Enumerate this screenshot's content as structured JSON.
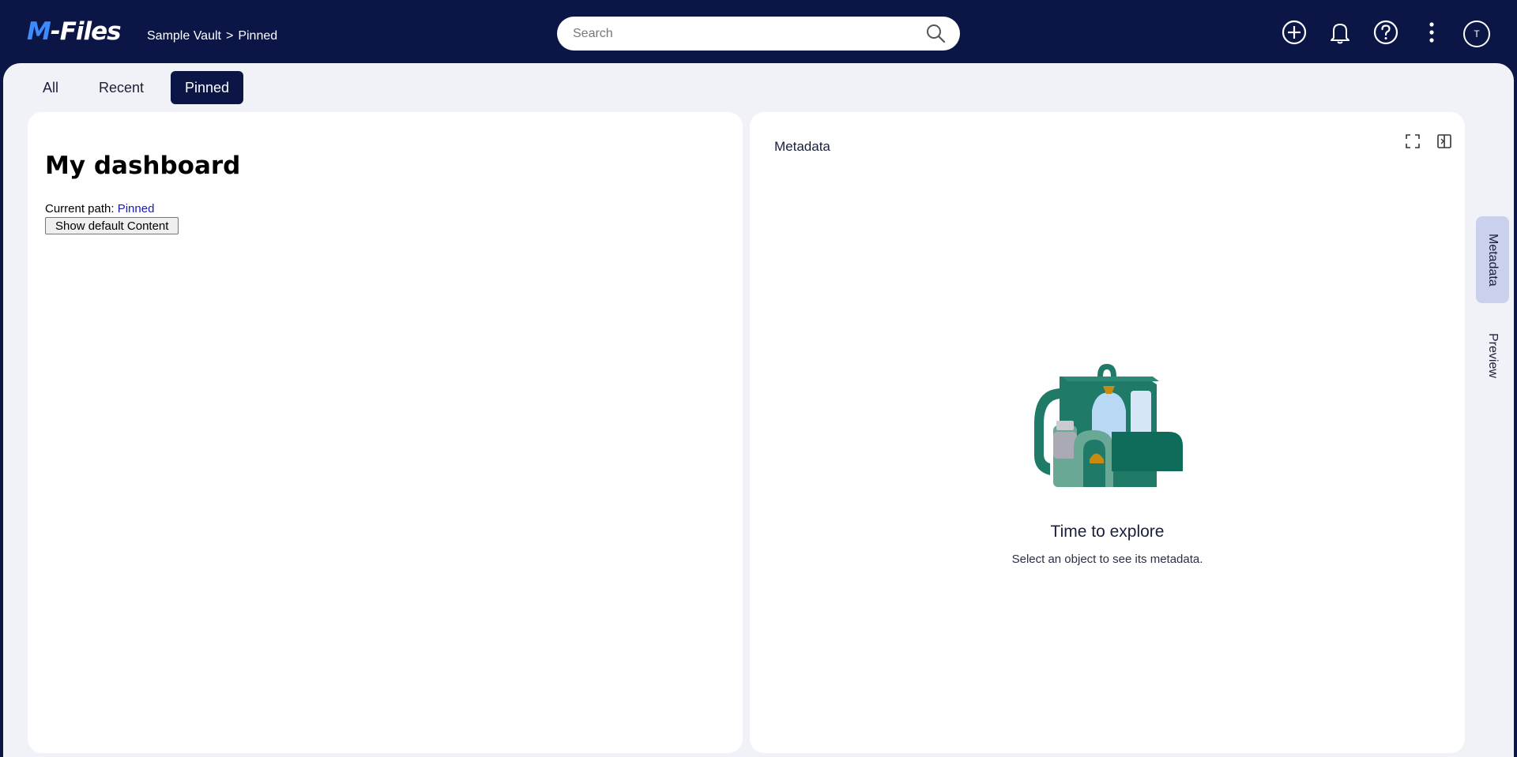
{
  "app": {
    "logo_prefix": "M",
    "logo_rest": "-Files"
  },
  "breadcrumb": {
    "vault": "Sample Vault",
    "separator": ">",
    "current": "Pinned"
  },
  "search": {
    "placeholder": "Search"
  },
  "toolbar": {
    "icons": [
      "add-icon",
      "bell-icon",
      "help-icon",
      "more-vertical-icon"
    ],
    "avatar_initial": "T"
  },
  "tabs": [
    {
      "label": "All",
      "active": false
    },
    {
      "label": "Recent",
      "active": false
    },
    {
      "label": "Pinned",
      "active": true
    }
  ],
  "dashboard": {
    "title": "My dashboard",
    "path_label": "Current path:",
    "path_value": "Pinned",
    "button_label": "Show default Content"
  },
  "metadata_panel": {
    "title": "Metadata",
    "empty_title": "Time to explore",
    "empty_subtitle": "Select an object to see its metadata."
  },
  "side_rail": {
    "tabs": [
      {
        "label": "Metadata",
        "active": true
      },
      {
        "label": "Preview",
        "active": false
      }
    ]
  },
  "colors": {
    "header_bg": "#0b1646",
    "workspace_bg": "#f1f2f8",
    "accent": "#3d8bff",
    "illustration_green": "#1f7a68"
  }
}
